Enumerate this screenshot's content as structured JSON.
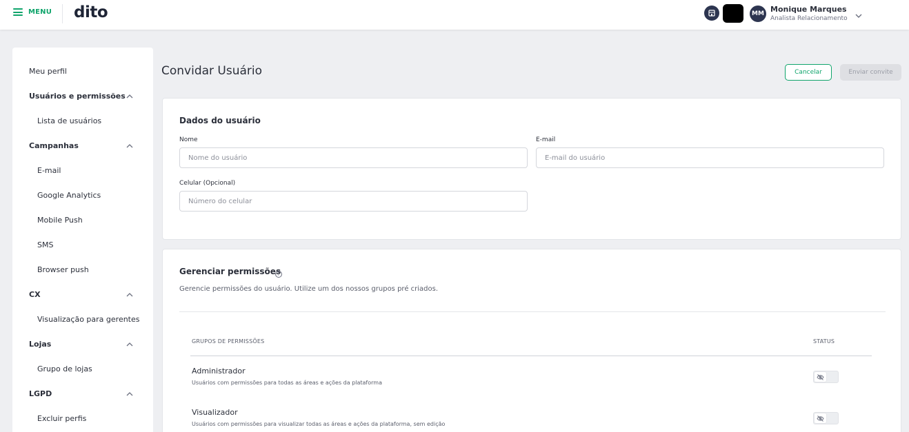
{
  "header": {
    "menu_label": "MENU",
    "logo_text": "dito",
    "user": {
      "initials": "MM",
      "name": "Monique Marques",
      "role": "Analista Relacionamento"
    },
    "accent_color": "#0fa46b"
  },
  "sidebar": {
    "items": [
      {
        "label": "Meu perfil"
      },
      {
        "label": "Usuários e permissões",
        "expanded": true
      },
      {
        "label": "Lista de usuários"
      },
      {
        "label": "Campanhas",
        "expanded": true
      },
      {
        "label": "E-mail"
      },
      {
        "label": "Google Analytics"
      },
      {
        "label": "Mobile Push"
      },
      {
        "label": "SMS"
      },
      {
        "label": "Browser push"
      },
      {
        "label": "CX",
        "expanded": true
      },
      {
        "label": "Visualização para gerentes"
      },
      {
        "label": "Lojas",
        "expanded": true
      },
      {
        "label": "Grupo de lojas"
      },
      {
        "label": "LGPD",
        "expanded": true
      },
      {
        "label": "Excluir perfis"
      }
    ]
  },
  "page": {
    "title": "Convidar Usuário",
    "cancel_label": "Cancelar",
    "send_label": "Enviar convite"
  },
  "user_data": {
    "title": "Dados do usuário",
    "name_label": "Nome",
    "name_placeholder": "Nome do usuário",
    "email_label": "E-mail",
    "email_placeholder": "E-mail do usuário",
    "phone_label": "Celular (Opcional)",
    "phone_placeholder": "Número do celular"
  },
  "permissions": {
    "title": "Gerenciar permissões",
    "description": "Gerencie permissões do usuário. Utilize um dos nossos grupos pré criados.",
    "col_groups": "GRUPOS DE PERMISSÕES",
    "col_status": "STATUS",
    "groups": [
      {
        "name": "Administrador",
        "description": "Usuários com permissões para todas as áreas e ações da plataforma",
        "enabled": false
      },
      {
        "name": "Visualizador",
        "description": "Usuários com permissões para visualizar todas as áreas e ações da plataforma, sem edição",
        "enabled": false
      }
    ]
  }
}
